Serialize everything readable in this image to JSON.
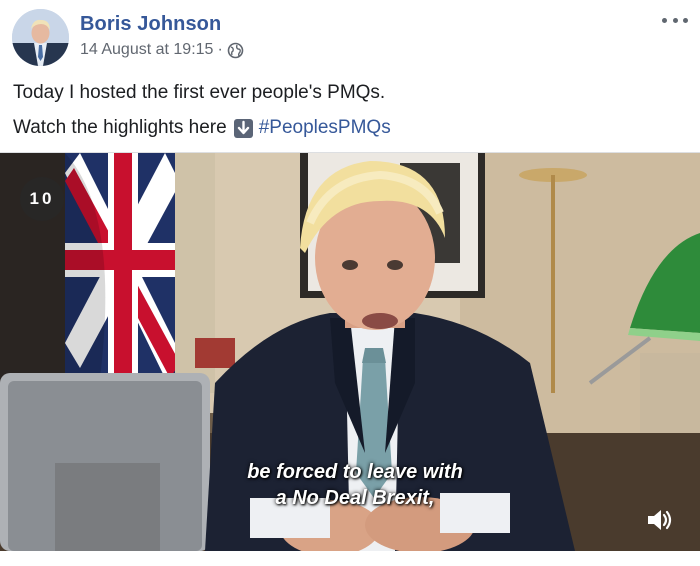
{
  "post": {
    "author": "Boris Johnson",
    "timestamp": "14 August at 19:15",
    "separator": "·",
    "privacy_icon": "globe-icon",
    "options_icon": "more-options-icon",
    "text_line1": "Today I hosted the first ever people's PMQs.",
    "text_line2": "Watch the highlights here",
    "inline_icon": "down-arrow-emoji-icon",
    "hashtag": "#PeoplesPMQs"
  },
  "video": {
    "counter": "10",
    "subtitle_line1": "be forced to leave with",
    "subtitle_line2": "a No Deal Brexit,",
    "volume_icon": "speaker-icon"
  },
  "colors": {
    "link": "#365899",
    "meta": "#616770",
    "text": "#1c1e21"
  }
}
